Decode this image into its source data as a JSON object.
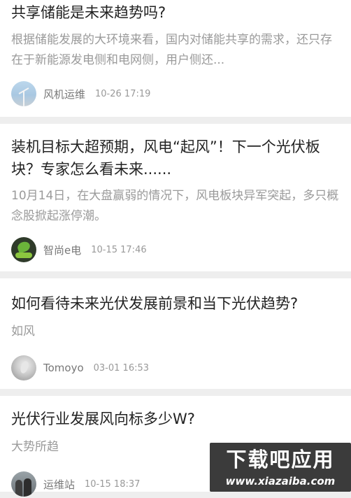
{
  "articles": [
    {
      "title": "共享储能是未来趋势吗?",
      "summary": "根据储能发展的大环境来看，国内对储能共享的需求，还只存在于新能源发电侧和电网侧，用户侧还...",
      "author": "风机运维",
      "time": "10-26 17:19",
      "avatar": "wind-turbine-avatar"
    },
    {
      "title": "装机目标大超预期，风电“起风”！下一个光伏板块？专家怎么看未来......",
      "summary": "10月14日，在大盘赢弱的情况下，风电板块异军突起，多只概念股掀起涨停潮。",
      "author": "智尚e电",
      "time": "10-15 17:46",
      "avatar": "leaf-logo-avatar"
    },
    {
      "title": "如何看待未来光伏发展前景和当下光伏趋势?",
      "summary": "如风",
      "author": "Tomoyo",
      "time": "03-01 16:53",
      "avatar": "grey-photo-avatar"
    },
    {
      "title": "光伏行业发展风向标多少W?",
      "summary": "大势所趋",
      "author": "运维站",
      "time": "10-15 18:37",
      "avatar": "people-photo-avatar"
    }
  ],
  "watermark": {
    "main": "下载吧应用",
    "url": "www.xiazaiba.com"
  },
  "colors": {
    "background": "#eeeeee",
    "card": "#ffffff",
    "title": "#222222",
    "summary": "#9a9a9a",
    "meta": "#999999",
    "watermark": "#3b3b3b"
  }
}
